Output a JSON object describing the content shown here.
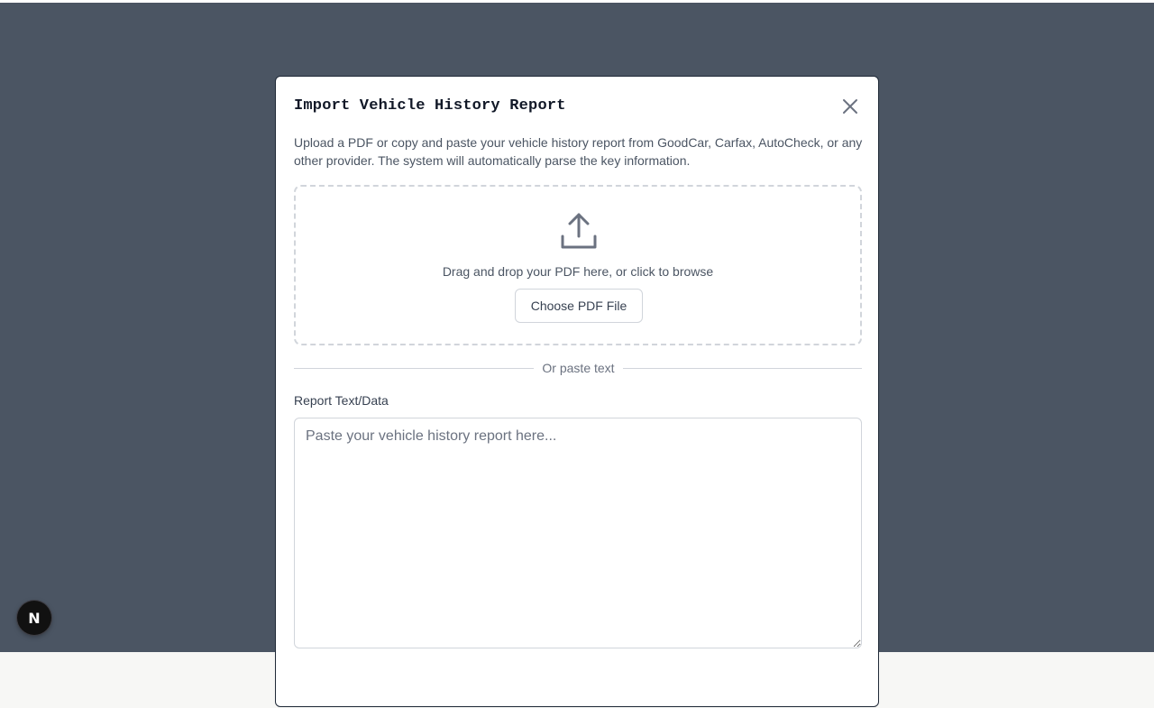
{
  "modal": {
    "title": "Import Vehicle History Report",
    "description": "Upload a PDF or copy and paste your vehicle history report from GoodCar, Carfax, AutoCheck, or any other provider. The system will automatically parse the key information.",
    "close_icon": "close-icon"
  },
  "dropzone": {
    "icon": "upload-icon",
    "text": "Drag and drop your PDF here, or click to browse",
    "button_label": "Choose PDF File"
  },
  "divider": {
    "label": "Or paste text"
  },
  "report_field": {
    "label": "Report Text/Data",
    "value": "",
    "placeholder": "Paste your vehicle history report here..."
  },
  "dev_badge": {
    "glyph": "N",
    "icon": "nextjs-icon"
  },
  "colors": {
    "overlay": "#4b5563",
    "modal_border": "#1f2937",
    "muted_text": "#4b5563"
  }
}
